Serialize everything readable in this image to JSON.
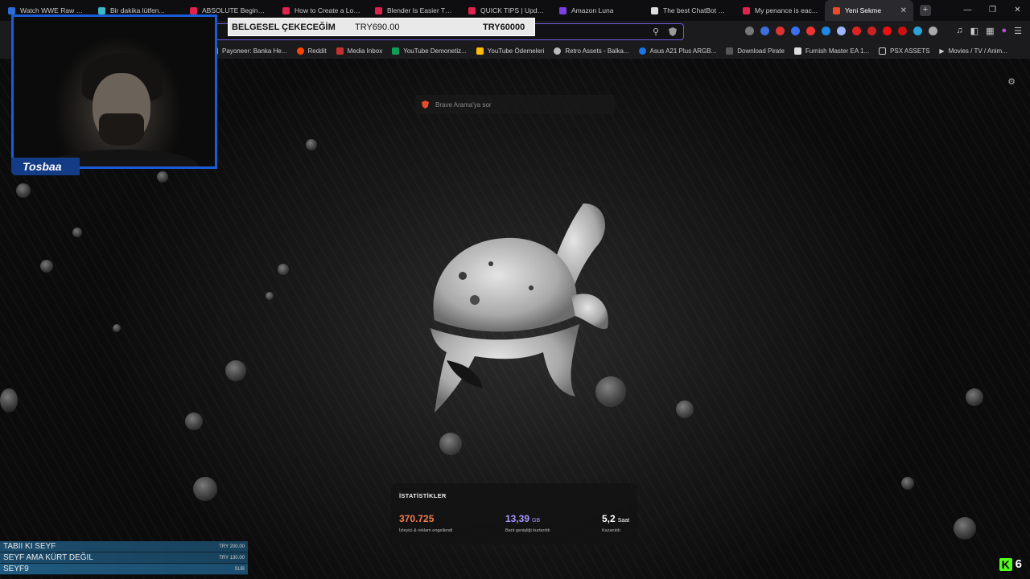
{
  "tabs": [
    {
      "title": "Watch WWE Raw Sma...",
      "favicon_color": "#2b6cd9",
      "active": false
    },
    {
      "title": "Bir dakika lütfen...",
      "favicon_color": "#3fb7c7",
      "active": false
    },
    {
      "title": "ABSOLUTE Beginner B...",
      "favicon_color": "#e0234e",
      "active": false
    },
    {
      "title": "How to Create a Low P...",
      "favicon_color": "#e0234e",
      "active": false
    },
    {
      "title": "Blender Is Easier Then...",
      "favicon_color": "#e0234e",
      "active": false
    },
    {
      "title": "QUICK TIPS | Update H...",
      "favicon_color": "#e0234e",
      "active": false
    },
    {
      "title": "Amazon Luna",
      "favicon_color": "#7b3fe4",
      "active": false
    },
    {
      "title": "The best ChatBot and...",
      "favicon_color": "#dddddd",
      "active": false
    },
    {
      "title": "My penance is eac...",
      "favicon_color": "#e0234e",
      "active": false
    },
    {
      "title": "Yeni Sekme",
      "favicon_color": "#ea4b2b",
      "active": true,
      "close": "✕"
    }
  ],
  "window_controls": [
    "—",
    "❐",
    "✕"
  ],
  "bookmarks": [
    {
      "label": "Payoneer: Banka He...",
      "color": "#e87b2a"
    },
    {
      "label": "Reddit",
      "color": "#ff4500"
    },
    {
      "label": "Media Inbox",
      "color": "#c4302b"
    },
    {
      "label": "YouTube Demonetiz...",
      "color": "#0f9d58"
    },
    {
      "label": "YouTube Ödemeleri",
      "color": "#fbbc05"
    },
    {
      "label": "Retro Assets - Balka...",
      "color": "#cccccc"
    },
    {
      "label": "Asus A21 Plus ARGB...",
      "color": "#1a73e8"
    },
    {
      "label": "Download Pirate",
      "color": "#666666"
    },
    {
      "label": "Furnish Master EA 1...",
      "color": "#dddddd"
    },
    {
      "label": "PSX ASSETS",
      "color": "#cccccc"
    },
    {
      "label": "Movies / TV / Anim...",
      "color": "#cccccc"
    }
  ],
  "new_tab": {
    "ask_placeholder": "Brave Arama'ya sor",
    "stats_title": "İSTATİSTİKLER",
    "stats": [
      {
        "value": "370.725",
        "unit": "",
        "label": "İzleyici & reklam engellendi",
        "color": "#f47c4c"
      },
      {
        "value": "13,39",
        "unit": "GB",
        "label": "Bant genişliği kurtarıldı",
        "color": "#a897ff"
      },
      {
        "value": "5,2",
        "unit": "Saat",
        "label": "Kazanıldı",
        "color": "#ffffff"
      }
    ]
  },
  "overlay": {
    "streamer_name": "Tosbaa",
    "banner": {
      "title": "BELGESEL ÇEKECEĞİM",
      "current": "TRY690.00",
      "goal": "TRY60000"
    },
    "donations": [
      {
        "text": "TABII KI SEYF",
        "amount": "TRY 200.00"
      },
      {
        "text": "SEYF AMA KÜRT DEĞIL",
        "amount": "TRY 130.00"
      },
      {
        "text": "SEYF9",
        "amount": "SUB"
      }
    ],
    "kick_logo": "K",
    "kick_count": "6"
  }
}
